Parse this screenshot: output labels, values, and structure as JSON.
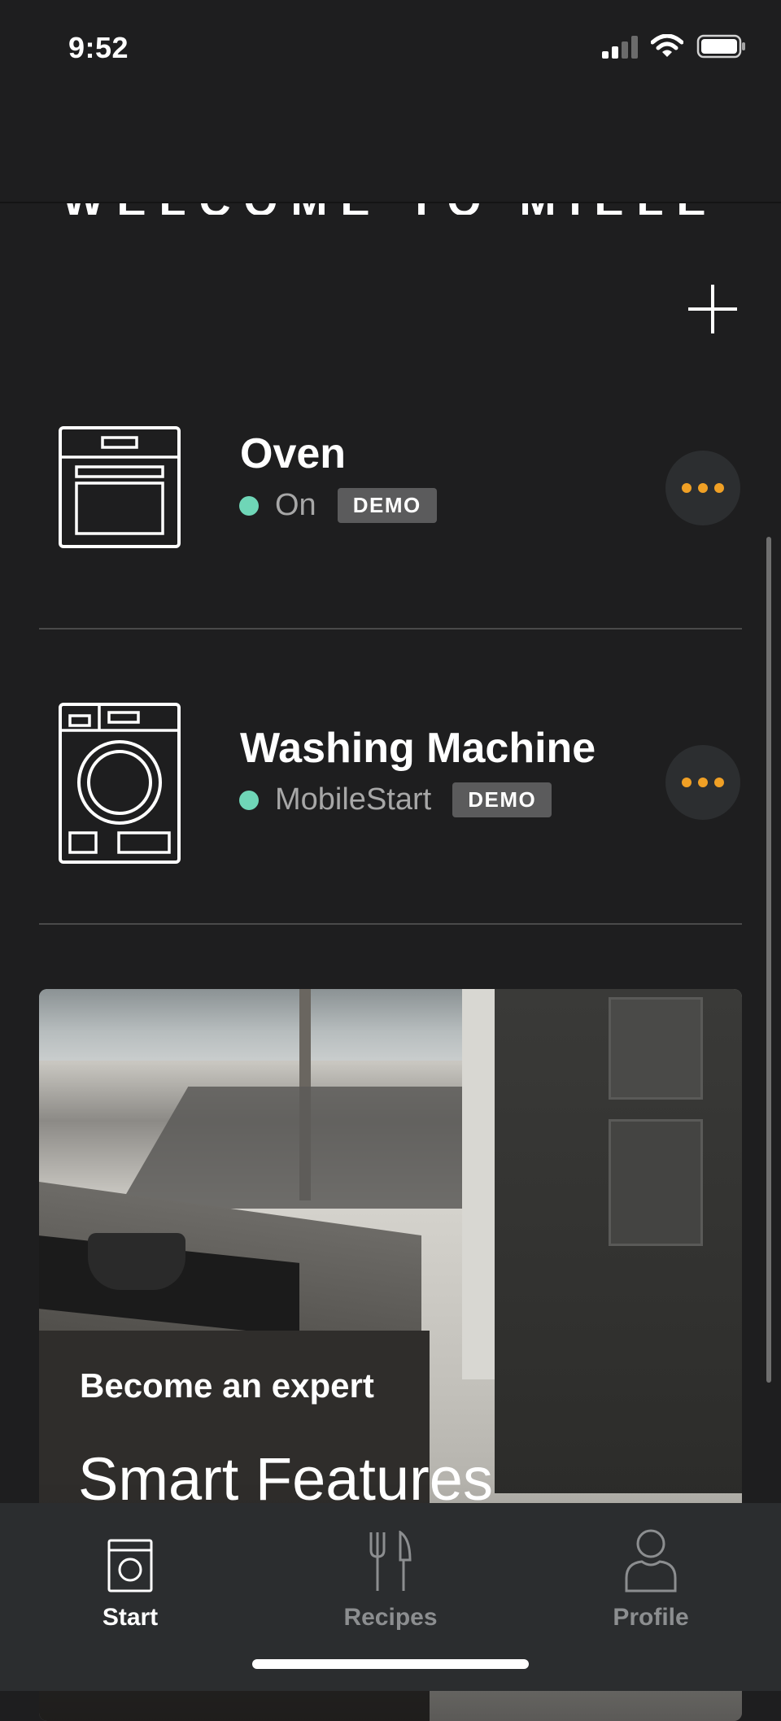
{
  "status_bar": {
    "time": "9:52"
  },
  "header": {
    "title": "WELCOME TO MIELE"
  },
  "devices": [
    {
      "name": "Oven",
      "status": "On",
      "badge": "DEMO",
      "icon": "oven-icon"
    },
    {
      "name": "Washing Machine",
      "status": "MobileStart",
      "badge": "DEMO",
      "icon": "washing-machine-icon"
    }
  ],
  "promo": {
    "kicker": "Become an expert",
    "title": "Smart Features"
  },
  "tabs": [
    {
      "label": "Start",
      "icon": "appliance-icon",
      "active": true
    },
    {
      "label": "Recipes",
      "icon": "cutlery-icon",
      "active": false
    },
    {
      "label": "Profile",
      "icon": "user-icon",
      "active": false
    }
  ],
  "colors": {
    "background": "#1e1e1f",
    "accent_dots": "#f0a025",
    "status_on": "#6fd6b7",
    "tab_inactive": "#8c8e90",
    "tab_bar": "#2b2d2f"
  }
}
